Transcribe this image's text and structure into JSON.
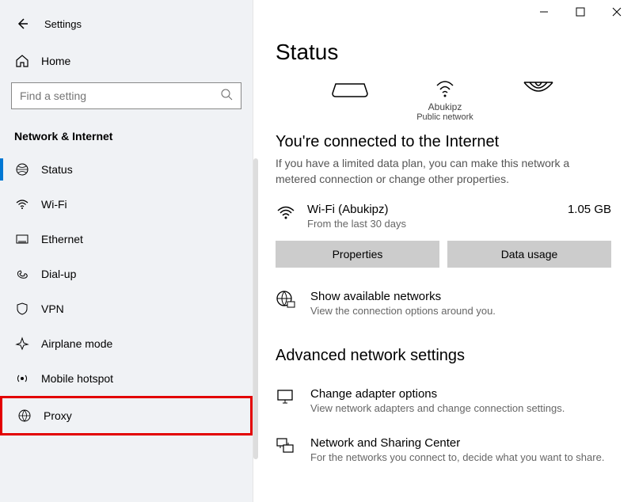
{
  "app_title": "Settings",
  "search": {
    "placeholder": "Find a setting"
  },
  "home_label": "Home",
  "category_title": "Network & Internet",
  "sidebar": {
    "items": [
      {
        "label": "Status"
      },
      {
        "label": "Wi-Fi"
      },
      {
        "label": "Ethernet"
      },
      {
        "label": "Dial-up"
      },
      {
        "label": "VPN"
      },
      {
        "label": "Airplane mode"
      },
      {
        "label": "Mobile hotspot"
      },
      {
        "label": "Proxy"
      }
    ]
  },
  "page": {
    "title": "Status",
    "diagram": {
      "center_label": "Abukipz",
      "center_sub": "Public network"
    },
    "connected_heading": "You're connected to the Internet",
    "connected_text": "If you have a limited data plan, you can make this network a metered connection or change other properties.",
    "connection": {
      "name": "Wi-Fi (Abukipz)",
      "sub": "From the last 30 days",
      "usage": "1.05 GB"
    },
    "buttons": {
      "properties": "Properties",
      "data_usage": "Data usage"
    },
    "show_networks": {
      "title": "Show available networks",
      "sub": "View the connection options around you."
    },
    "advanced_heading": "Advanced network settings",
    "adapter": {
      "title": "Change adapter options",
      "sub": "View network adapters and change connection settings."
    },
    "sharing": {
      "title": "Network and Sharing Center",
      "sub": "For the networks you connect to, decide what you want to share."
    }
  }
}
